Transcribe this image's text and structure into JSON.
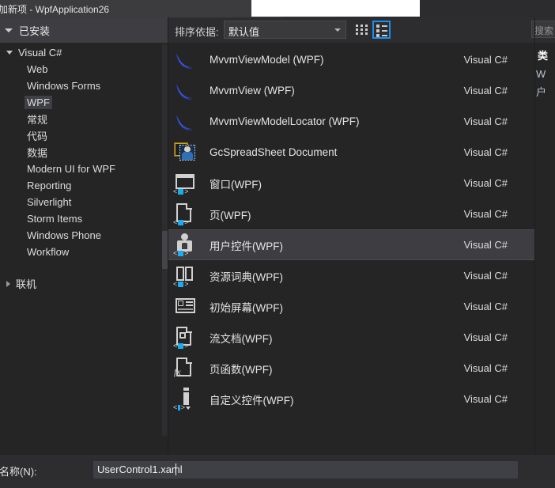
{
  "window": {
    "title": "加新项 - WpfApplication26"
  },
  "sidebar": {
    "header": "已安装",
    "root": {
      "label": "Visual C#",
      "expanded": true
    },
    "items": [
      {
        "label": "Web",
        "selected": false
      },
      {
        "label": "Windows Forms",
        "selected": false
      },
      {
        "label": "WPF",
        "selected": true
      },
      {
        "label": "常规",
        "selected": false
      },
      {
        "label": "代码",
        "selected": false
      },
      {
        "label": "数据",
        "selected": false
      },
      {
        "label": "Modern UI for WPF",
        "selected": false
      },
      {
        "label": "Reporting",
        "selected": false
      },
      {
        "label": "Silverlight",
        "selected": false
      },
      {
        "label": "Storm Items",
        "selected": false
      },
      {
        "label": "Windows Phone",
        "selected": false
      },
      {
        "label": "Workflow",
        "selected": false
      }
    ],
    "online": {
      "label": "联机",
      "expanded": false
    }
  },
  "toolbar": {
    "sort_label": "排序依据:",
    "sort_value": "默认值",
    "view_grid_icon": "grid-view-icon",
    "view_list_icon": "list-view-icon",
    "view_selected": "list"
  },
  "search": {
    "placeholder": "搜索"
  },
  "templates": {
    "lang_label": "Visual C#",
    "items": [
      {
        "name": "MvvmViewModel (WPF)",
        "lang": "Visual C#",
        "icon": "mvvm-swoosh-icon",
        "selected": false
      },
      {
        "name": "MvvmView (WPF)",
        "lang": "Visual C#",
        "icon": "mvvm-swoosh-icon",
        "selected": false
      },
      {
        "name": "MvvmViewModelLocator (WPF)",
        "lang": "Visual C#",
        "icon": "mvvm-swoosh-icon",
        "selected": false
      },
      {
        "name": "GcSpreadSheet Document",
        "lang": "Visual C#",
        "icon": "spreadsheet-document-icon",
        "selected": false
      },
      {
        "name": "窗口(WPF)",
        "lang": "Visual C#",
        "icon": "window-icon",
        "selected": false
      },
      {
        "name": "页(WPF)",
        "lang": "Visual C#",
        "icon": "page-icon",
        "selected": false
      },
      {
        "name": "用户控件(WPF)",
        "lang": "Visual C#",
        "icon": "user-control-icon",
        "selected": true
      },
      {
        "name": "资源词典(WPF)",
        "lang": "Visual C#",
        "icon": "resource-dictionary-icon",
        "selected": false
      },
      {
        "name": "初始屏幕(WPF)",
        "lang": "Visual C#",
        "icon": "splash-screen-icon",
        "selected": false
      },
      {
        "name": "流文档(WPF)",
        "lang": "Visual C#",
        "icon": "flow-document-icon",
        "selected": false
      },
      {
        "name": "页函数(WPF)",
        "lang": "Visual C#",
        "icon": "page-function-icon",
        "selected": false
      },
      {
        "name": "自定义控件(WPF)",
        "lang": "Visual C#",
        "icon": "custom-control-icon",
        "selected": false
      }
    ]
  },
  "details": {
    "title": "类",
    "line1": "W",
    "line2": "户"
  },
  "footer": {
    "name_label": "名称(N):",
    "name_value": "UserControl1.xaml"
  },
  "colors": {
    "accent": "#1b8ff0",
    "window_bg": "#252526",
    "panel_bg": "#2d2d30",
    "selection": "#3e3e42",
    "xaml_badge": "#1badf0"
  }
}
